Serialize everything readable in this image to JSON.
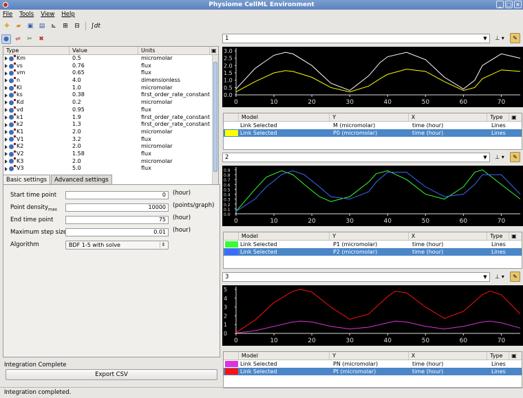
{
  "window": {
    "title": "Physiome CellML Environment"
  },
  "menu": {
    "items": [
      "File",
      "Tools",
      "View",
      "Help"
    ]
  },
  "variables": {
    "headers": [
      "Type",
      "Value",
      "Units"
    ],
    "rows": [
      {
        "name": "Km",
        "value": "0.5",
        "units": "micromolar"
      },
      {
        "name": "vs",
        "value": "0.76",
        "units": "flux"
      },
      {
        "name": "vm",
        "value": "0.65",
        "units": "flux"
      },
      {
        "name": "n",
        "value": "4.0",
        "units": "dimensionless"
      },
      {
        "name": "KI",
        "value": "1.0",
        "units": "micromolar"
      },
      {
        "name": "ks",
        "value": "0.38",
        "units": "first_order_rate_constant"
      },
      {
        "name": "Kd",
        "value": "0.2",
        "units": "micromolar"
      },
      {
        "name": "vd",
        "value": "0.95",
        "units": "flux"
      },
      {
        "name": "k1",
        "value": "1.9",
        "units": "first_order_rate_constant"
      },
      {
        "name": "k2",
        "value": "1.3",
        "units": "first_order_rate_constant"
      },
      {
        "name": "K1",
        "value": "2.0",
        "units": "micromolar"
      },
      {
        "name": "V1",
        "value": "3.2",
        "units": "flux"
      },
      {
        "name": "K2",
        "value": "2.0",
        "units": "micromolar"
      },
      {
        "name": "V2",
        "value": "1.58",
        "units": "flux"
      },
      {
        "name": "K3",
        "value": "2.0",
        "units": "micromolar"
      },
      {
        "name": "V3",
        "value": "5.0",
        "units": "flux"
      }
    ]
  },
  "tabs": {
    "basic": "Basic settings",
    "advanced": "Advanced settings"
  },
  "settings": {
    "start_label": "Start time point",
    "start_value": "0",
    "start_unit": "(hour)",
    "density_label": "Point density",
    "density_sub": "max",
    "density_value": "10000",
    "density_unit": "(points/graph)",
    "end_label": "End time point",
    "end_value": "75",
    "end_unit": "(hour)",
    "step_label": "Maximum step size",
    "step_value": "0.01",
    "step_unit": "(hour)",
    "algo_label": "Algorithm",
    "algo_value": "BDF 1-5 with solve"
  },
  "integration_status": "Integration Complete",
  "export_label": "Export CSV",
  "status_bar": "Integration completed.",
  "graph_headers": [
    "Model",
    "Y",
    "X",
    "Type"
  ],
  "graphs": [
    {
      "name": "1",
      "ylim": [
        0,
        3.0
      ],
      "yticks": [
        "0.0",
        "0.5",
        "1.0",
        "1.5",
        "2.0",
        "2.5",
        "3.0"
      ],
      "xticks": [
        "0",
        "10",
        "20",
        "30",
        "40",
        "50",
        "60",
        "70"
      ],
      "xlim": [
        0,
        75
      ],
      "rows": [
        {
          "color": "#ffffff",
          "model": "Link Selected",
          "y": "M (micromolar)",
          "x": "time (hour)",
          "type": "Lines",
          "selected": false
        },
        {
          "color": "#ffff00",
          "model": "Link Selected",
          "y": "P0 (micromolar)",
          "x": "time (hour)",
          "type": "Lines",
          "selected": true
        }
      ]
    },
    {
      "name": "2",
      "ylim": [
        0,
        0.9
      ],
      "yticks": [
        "0.0",
        "0.1",
        "0.2",
        "0.3",
        "0.4",
        "0.5",
        "0.6",
        "0.7",
        "0.8",
        "0.9"
      ],
      "xticks": [
        "0",
        "10",
        "20",
        "30",
        "40",
        "50",
        "60",
        "70"
      ],
      "xlim": [
        0,
        75
      ],
      "rows": [
        {
          "color": "#33ff33",
          "model": "Link Selected",
          "y": "P1 (micromolar)",
          "x": "time (hour)",
          "type": "Lines",
          "selected": false
        },
        {
          "color": "#3b6cff",
          "model": "Link Selected",
          "y": "P2 (micromolar)",
          "x": "time (hour)",
          "type": "Lines",
          "selected": true
        }
      ]
    },
    {
      "name": "3",
      "ylim": [
        0,
        5
      ],
      "yticks": [
        "0",
        "1",
        "2",
        "3",
        "4",
        "5"
      ],
      "xticks": [
        "0",
        "10",
        "20",
        "30",
        "40",
        "50",
        "60",
        "70"
      ],
      "xlim": [
        0,
        75
      ],
      "rows": [
        {
          "color": "#dd33dd",
          "model": "Link Selected",
          "y": "PN (micromolar)",
          "x": "time (hour)",
          "type": "Lines",
          "selected": false
        },
        {
          "color": "#ff1111",
          "model": "Link Selected",
          "y": "Pt (micromolar)",
          "x": "time (hour)",
          "type": "Lines",
          "selected": true
        }
      ]
    }
  ],
  "chart_data": [
    {
      "type": "line",
      "x": [
        0,
        5,
        10,
        13,
        15,
        20,
        25,
        30,
        35,
        38,
        40,
        45,
        50,
        55,
        60,
        63,
        65,
        70,
        75
      ],
      "series": [
        {
          "color": "#ffffff",
          "values": [
            0.4,
            1.8,
            2.7,
            2.9,
            2.8,
            2.0,
            0.8,
            0.3,
            1.3,
            2.2,
            2.6,
            2.9,
            2.4,
            1.2,
            0.4,
            1.0,
            2.0,
            2.8,
            2.5
          ]
        },
        {
          "color": "#ffff00",
          "values": [
            0.2,
            0.9,
            1.5,
            1.65,
            1.6,
            1.2,
            0.5,
            0.2,
            0.6,
            1.1,
            1.4,
            1.75,
            1.6,
            0.9,
            0.3,
            0.5,
            1.1,
            1.7,
            1.6
          ]
        }
      ],
      "xlim": [
        0,
        75
      ],
      "ylim": [
        0,
        3.0
      ]
    },
    {
      "type": "line",
      "x": [
        0,
        5,
        8,
        12,
        15,
        18,
        22,
        25,
        30,
        35,
        37,
        40,
        45,
        50,
        55,
        60,
        63,
        65,
        70,
        75
      ],
      "series": [
        {
          "color": "#33ff33",
          "values": [
            0.05,
            0.5,
            0.75,
            0.88,
            0.8,
            0.6,
            0.35,
            0.25,
            0.35,
            0.65,
            0.82,
            0.88,
            0.7,
            0.4,
            0.3,
            0.55,
            0.85,
            0.9,
            0.6,
            0.3
          ]
        },
        {
          "color": "#3b6cff",
          "values": [
            0.05,
            0.3,
            0.55,
            0.8,
            0.88,
            0.8,
            0.55,
            0.35,
            0.3,
            0.45,
            0.65,
            0.85,
            0.85,
            0.55,
            0.35,
            0.4,
            0.6,
            0.8,
            0.8,
            0.4
          ]
        }
      ],
      "xlim": [
        0,
        75
      ],
      "ylim": [
        0,
        0.9
      ]
    },
    {
      "type": "line",
      "x": [
        0,
        5,
        10,
        15,
        17,
        20,
        25,
        30,
        35,
        40,
        42,
        45,
        50,
        55,
        60,
        65,
        67,
        70,
        75
      ],
      "series": [
        {
          "color": "#ff1111",
          "values": [
            0.1,
            1.5,
            3.5,
            4.8,
            5.0,
            4.7,
            3.0,
            1.6,
            2.2,
            4.2,
            4.8,
            4.6,
            3.0,
            1.7,
            2.5,
            4.4,
            4.8,
            4.4,
            2.2
          ]
        },
        {
          "color": "#dd33dd",
          "values": [
            0.05,
            0.3,
            0.8,
            1.3,
            1.4,
            1.3,
            0.8,
            0.5,
            0.7,
            1.2,
            1.4,
            1.3,
            0.8,
            0.5,
            0.8,
            1.3,
            1.4,
            1.2,
            0.6
          ]
        }
      ],
      "xlim": [
        0,
        75
      ],
      "ylim": [
        0,
        5
      ]
    }
  ]
}
